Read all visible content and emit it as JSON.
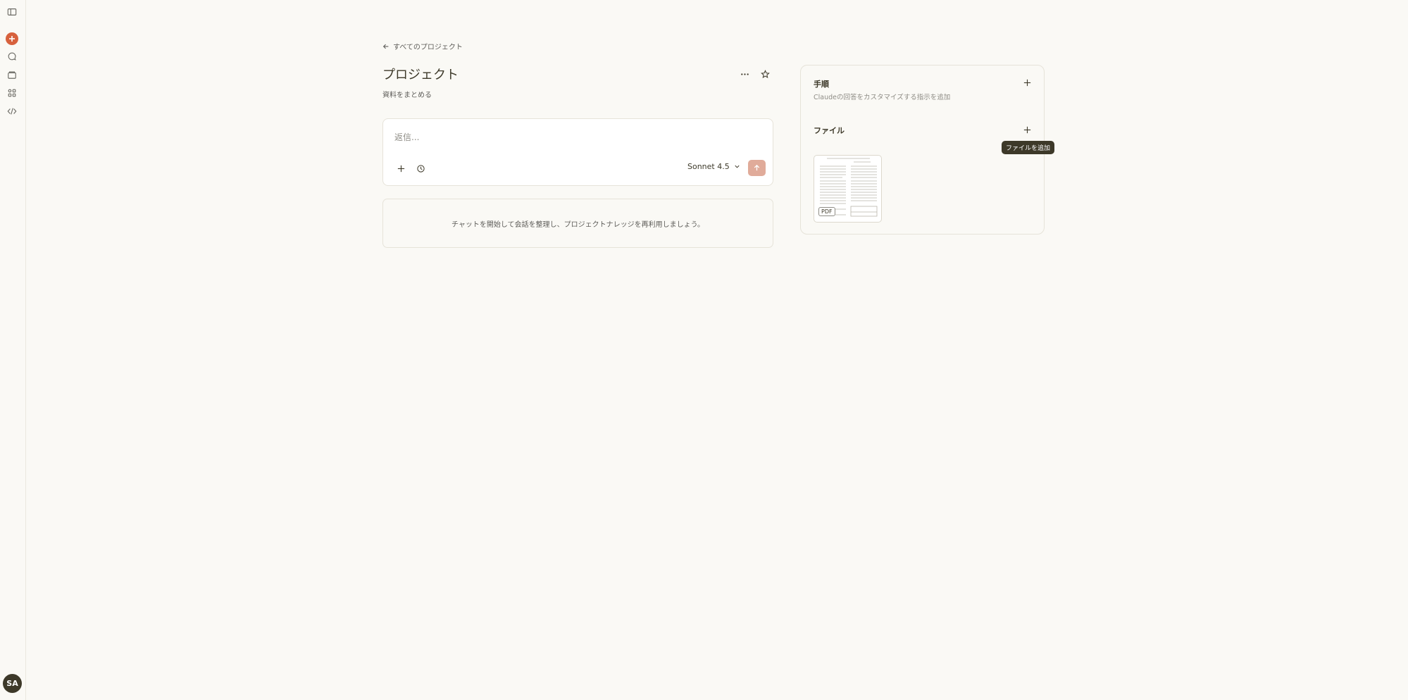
{
  "rail": {
    "items": [
      "sidebar-toggle-icon",
      "new-chat-icon",
      "chats-icon",
      "projects-icon",
      "artifacts-icon",
      "code-icon"
    ],
    "accent": "#d7613d",
    "user_initials": "SA"
  },
  "header": {
    "back_label": "すべてのプロジェクト",
    "title": "プロジェクト",
    "description": "資料をまとめる"
  },
  "composer": {
    "placeholder": "返信...",
    "model": "Sonnet 4.5"
  },
  "empty_state": "チャットを開始して会話を整理し、プロジェクトナレッジを再利用しましょう。",
  "side_panel": {
    "instructions_title": "手順",
    "instructions_desc": "Claudeの回答をカスタマイズする指示を追加",
    "files_title": "ファイル",
    "files": [
      {
        "type_label": "PDF"
      }
    ],
    "tooltip": "ファイルを追加"
  }
}
